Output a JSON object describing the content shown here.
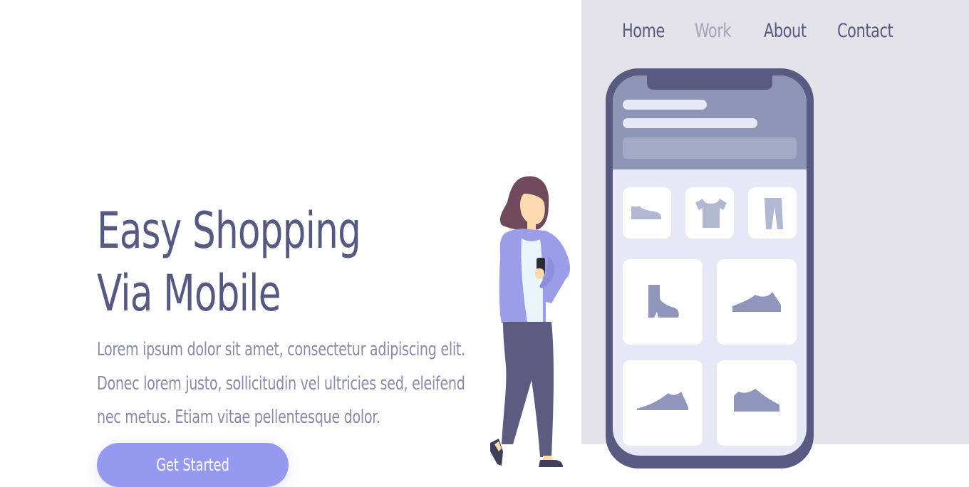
{
  "nav": {
    "items": [
      {
        "label": "Home",
        "active": false
      },
      {
        "label": "Work",
        "active": true
      },
      {
        "label": "About",
        "active": false
      },
      {
        "label": "Contact",
        "active": false
      }
    ]
  },
  "hero": {
    "title_line1": "Easy Shopping",
    "title_line2": "Via Mobile",
    "description": "Lorem ipsum dolor sit amet, consectetur adipiscing elit. Donec lorem justo, sollicitudin vel ultricies sed, eleifend nec metus. Etiam vitae pellentesque dolor.",
    "cta_label": "Get Started"
  },
  "colors": {
    "primary_text": "#565980",
    "muted_text": "#8a8aa6",
    "accent": "#959af0",
    "panel_bg": "#e4e3e9",
    "phone_frame": "#585a82"
  },
  "illustration": {
    "products": [
      "sneaker-icon",
      "tshirt-icon",
      "pants-icon",
      "boot-icon",
      "sneaker-icon",
      "sneaker-icon",
      "sneaker-icon"
    ]
  }
}
